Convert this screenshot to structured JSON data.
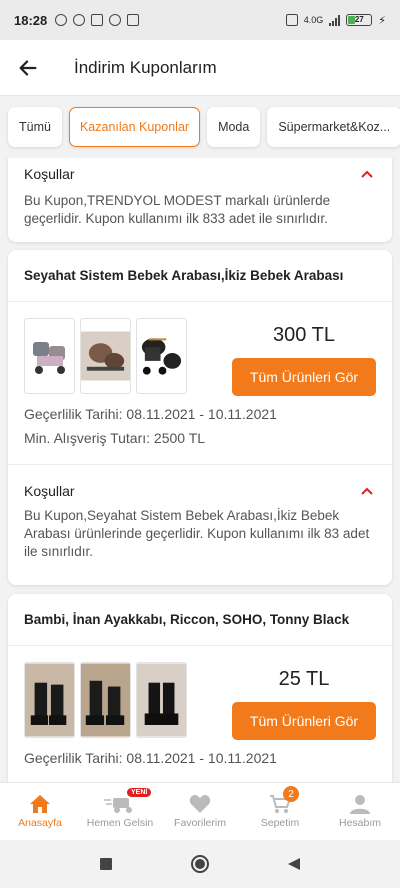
{
  "status": {
    "time": "18:28",
    "battery": "27",
    "network": "4.0G"
  },
  "header": {
    "title": "İndirim Kuponlarım"
  },
  "tabs": [
    {
      "label": "Tümü"
    },
    {
      "label": "Kazanılan Kuponlar",
      "active": true
    },
    {
      "label": "Moda"
    },
    {
      "label": "Süpermarket&Koz..."
    }
  ],
  "cards": [
    {
      "conditions_title": "Koşullar",
      "conditions_text": "Bu Kupon,TRENDYOL MODEST markalı ürünlerde geçerlidir. Kupon kullanımı ilk 833 adet ile sınırlıdır."
    },
    {
      "title": "Seyahat Sistem Bebek Arabası,İkiz Bebek Arabası",
      "price": "300 TL",
      "cta": "Tüm Ürünleri Gör",
      "validity": "Geçerlilik Tarihi: 08.11.2021 - 10.11.2021",
      "min_amount": "Min. Alışveriş Tutarı: 2500 TL",
      "conditions_title": "Koşullar",
      "conditions_text": "Bu Kupon,Seyahat Sistem Bebek Arabası,İkiz Bebek Arabası  ürünlerinde geçerlidir. Kupon kullanımı ilk 83 adet ile sınırlıdır."
    },
    {
      "title": "Bambi, İnan Ayakkabı, Riccon, SOHO, Tonny Black",
      "price": "25 TL",
      "cta": "Tüm Ürünleri Gör",
      "validity": "Geçerlilik Tarihi: 08.11.2021 - 10.11.2021"
    }
  ],
  "bottom_nav": [
    {
      "label": "Anasayfa",
      "icon": "home-icon",
      "active": true
    },
    {
      "label": "Hemen Gelsin",
      "icon": "delivery-icon",
      "badge": "YENİ"
    },
    {
      "label": "Favorilerim",
      "icon": "heart-icon"
    },
    {
      "label": "Sepetim",
      "icon": "cart-icon",
      "badge": "2"
    },
    {
      "label": "Hesabım",
      "icon": "user-icon"
    }
  ],
  "colors": {
    "accent": "#f27a1a",
    "badge_red": "#e02020"
  }
}
